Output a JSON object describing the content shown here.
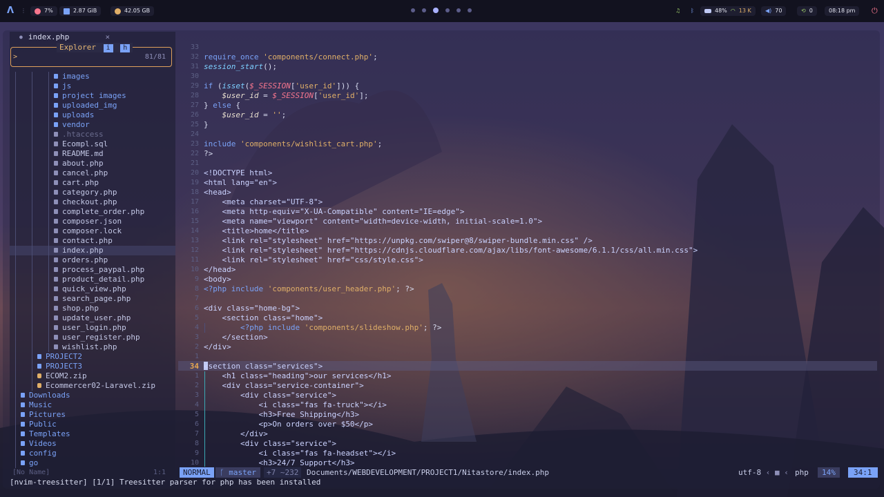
{
  "topbar": {
    "cpu": "7%",
    "ram": "2.87 GiB",
    "disk": "42.05 GB",
    "volume_level": "48%",
    "net_speed": "13 K",
    "volume": "70",
    "updates": "0",
    "clock": "08:18 pm"
  },
  "tab": {
    "filename": "index.php",
    "close": "×"
  },
  "explorer": {
    "title": "Explorer",
    "badge_i": "i",
    "badge_h": "h",
    "prompt": ">",
    "count": "81/81"
  },
  "tree": [
    {
      "label": "images",
      "kind": "dir"
    },
    {
      "label": "js",
      "kind": "dir"
    },
    {
      "label": "project images",
      "kind": "dir"
    },
    {
      "label": "uploaded_img",
      "kind": "dir"
    },
    {
      "label": "uploads",
      "kind": "dir"
    },
    {
      "label": "vendor",
      "kind": "dir"
    },
    {
      "label": ".htaccess",
      "kind": "dim"
    },
    {
      "label": "Ecompl.sql",
      "kind": "file"
    },
    {
      "label": "README.md",
      "kind": "file"
    },
    {
      "label": "about.php",
      "kind": "file"
    },
    {
      "label": "cancel.php",
      "kind": "file"
    },
    {
      "label": "cart.php",
      "kind": "file"
    },
    {
      "label": "category.php",
      "kind": "file"
    },
    {
      "label": "checkout.php",
      "kind": "file"
    },
    {
      "label": "complete_order.php",
      "kind": "file"
    },
    {
      "label": "composer.json",
      "kind": "file"
    },
    {
      "label": "composer.lock",
      "kind": "file"
    },
    {
      "label": "contact.php",
      "kind": "file"
    },
    {
      "label": "index.php",
      "kind": "file",
      "selected": true
    },
    {
      "label": "orders.php",
      "kind": "file"
    },
    {
      "label": "process_paypal.php",
      "kind": "file"
    },
    {
      "label": "product_detail.php",
      "kind": "file"
    },
    {
      "label": "quick_view.php",
      "kind": "file"
    },
    {
      "label": "search_page.php",
      "kind": "file"
    },
    {
      "label": "shop.php",
      "kind": "file"
    },
    {
      "label": "update_user.php",
      "kind": "file"
    },
    {
      "label": "user_login.php",
      "kind": "file"
    },
    {
      "label": "user_register.php",
      "kind": "file"
    },
    {
      "label": "wishlist.php",
      "kind": "file"
    },
    {
      "label": "PROJECT2",
      "kind": "dir"
    },
    {
      "label": "PROJECT3",
      "kind": "dir"
    },
    {
      "label": "ECOM2.zip",
      "kind": "zip"
    },
    {
      "label": "Ecommercer02-Laravel.zip",
      "kind": "zip"
    },
    {
      "label": "Downloads",
      "kind": "dir"
    },
    {
      "label": "Music",
      "kind": "dir"
    },
    {
      "label": "Pictures",
      "kind": "dir"
    },
    {
      "label": "Public",
      "kind": "dir"
    },
    {
      "label": "Templates",
      "kind": "dir"
    },
    {
      "label": "Videos",
      "kind": "dir"
    },
    {
      "label": "config",
      "kind": "dir"
    },
    {
      "label": "go",
      "kind": "dir"
    }
  ],
  "code": {
    "cursor_line": "34",
    "lines": [
      {
        "n": "33",
        "html": "<?php"
      },
      {
        "n": "32",
        "html": "<span class=\"kw\">require_once</span> <span class=\"str\">'components/connect.php'</span>;"
      },
      {
        "n": "31",
        "html": "<span class=\"fn\">session_start</span>();"
      },
      {
        "n": "30",
        "html": ""
      },
      {
        "n": "29",
        "html": "<span class=\"kw\">if</span> (<span class=\"fn\">isset</span>(<span class=\"sup\">$_SESSION</span>[<span class=\"str\">'user_id'</span>])) {"
      },
      {
        "n": "28",
        "html": "    <span class=\"var\">$user_id</span> = <span class=\"sup\">$_SESSION</span>[<span class=\"str\">'user_id'</span>];"
      },
      {
        "n": "27",
        "html": "} <span class=\"kw\">else</span> {"
      },
      {
        "n": "26",
        "html": "    <span class=\"var\">$user_id</span> = <span class=\"str\">''</span>;"
      },
      {
        "n": "25",
        "html": "}"
      },
      {
        "n": "24",
        "html": ""
      },
      {
        "n": "23",
        "html": "<span class=\"kw\">include</span> <span class=\"str\">'components/wishlist_cart.php'</span>;"
      },
      {
        "n": "22",
        "html": "?>"
      },
      {
        "n": "21",
        "html": ""
      },
      {
        "n": "20",
        "html": "<span class=\"tg\">&lt;!DOCTYPE html&gt;</span>"
      },
      {
        "n": "19",
        "html": "<span class=\"tg\">&lt;html lang=\"en\"&gt;</span>"
      },
      {
        "n": "18",
        "html": "<span class=\"tg\">&lt;head&gt;</span>"
      },
      {
        "n": "17",
        "html": "    <span class=\"tg\">&lt;meta charset=\"UTF-8\"&gt;</span>"
      },
      {
        "n": "16",
        "html": "    <span class=\"tg\">&lt;meta http-equiv=\"X-UA-Compatible\" content=\"IE=edge\"&gt;</span>"
      },
      {
        "n": "15",
        "html": "    <span class=\"tg\">&lt;meta name=\"viewport\" content=\"width=device-width, initial-scale=1.0\"&gt;</span>"
      },
      {
        "n": "14",
        "html": "    <span class=\"tg\">&lt;title&gt;home&lt;/title&gt;</span>"
      },
      {
        "n": "13",
        "html": "    <span class=\"tg\">&lt;link rel=\"stylesheet\" href=\"https://unpkg.com/swiper@8/swiper-bundle.min.css\" /&gt;</span>"
      },
      {
        "n": "12",
        "html": "    <span class=\"tg\">&lt;link rel=\"stylesheet\" href=\"https://cdnjs.cloudflare.com/ajax/libs/font-awesome/6.1.1/css/all.min.css\"&gt;</span>"
      },
      {
        "n": "11",
        "html": "    <span class=\"tg\">&lt;link rel=\"stylesheet\" href=\"css/style.css\"&gt;</span>"
      },
      {
        "n": "10",
        "html": "<span class=\"tg\">&lt;/head&gt;</span>"
      },
      {
        "n": "9",
        "html": "<span class=\"tg\">&lt;body&gt;</span>"
      },
      {
        "n": "8",
        "html": "<span class=\"kw\">&lt;?php include</span> <span class=\"str\">'components/user_header.php'</span>; ?&gt;"
      },
      {
        "n": "7",
        "html": ""
      },
      {
        "n": "6",
        "html": "<span class=\"tg\">&lt;div class=\"home-bg\"&gt;</span>"
      },
      {
        "n": "5",
        "html": "    <span class=\"tg\">&lt;section class=\"home\"&gt;</span>"
      },
      {
        "n": "4",
        "html": "        <span class=\"kw\">&lt;?php include</span> <span class=\"str\">'components/slideshow.php'</span>; ?&gt;"
      },
      {
        "n": "3",
        "html": "    <span class=\"tg\">&lt;/section&gt;</span>"
      },
      {
        "n": "2",
        "html": "<span class=\"tg\">&lt;/div&gt;</span>"
      },
      {
        "n": "1",
        "html": ""
      },
      {
        "n": "34",
        "html": "<span class=\"tg\">&lt;section class=\"services\"&gt;</span>",
        "cur": true
      },
      {
        "n": "1",
        "html": "    <span class=\"tg\">&lt;h1 class=\"heading\"&gt;our services&lt;/h1&gt;</span>"
      },
      {
        "n": "2",
        "html": "    <span class=\"tg\">&lt;div class=\"service-container\"&gt;</span>"
      },
      {
        "n": "3",
        "html": "        <span class=\"tg\">&lt;div class=\"service\"&gt;</span>"
      },
      {
        "n": "4",
        "html": "            <span class=\"tg\">&lt;i class=\"fas fa-truck\"&gt;&lt;/i&gt;</span>"
      },
      {
        "n": "5",
        "html": "            <span class=\"tg\">&lt;h3&gt;Free Shipping&lt;/h3&gt;</span>"
      },
      {
        "n": "6",
        "html": "            <span class=\"tg\">&lt;p&gt;On orders over $50&lt;/p&gt;</span>"
      },
      {
        "n": "7",
        "html": "        <span class=\"tg\">&lt;/div&gt;</span>"
      },
      {
        "n": "8",
        "html": "        <span class=\"tg\">&lt;div class=\"service\"&gt;</span>"
      },
      {
        "n": "9",
        "html": "            <span class=\"tg\">&lt;i class=\"fas fa-headset\"&gt;&lt;/i&gt;</span>"
      },
      {
        "n": "10",
        "html": "            <span class=\"tg\">&lt;h3&gt;24/7 Support&lt;/h3&gt;</span>"
      }
    ]
  },
  "status": {
    "noname": "[No Name]",
    "noname_pos": "1:1",
    "mode": "NORMAL",
    "branch": "master",
    "diff": "+7 ~232",
    "path": "Documents/WEBDEVELOPMENT/PROJECT1/Nitastore/index.php",
    "encoding": "utf-8",
    "filetype": "php",
    "percent": "14%",
    "position": "34:1"
  },
  "message": "[nvim-treesitter] [1/1] Treesitter parser for php has been installed",
  "colors": {
    "accent": "#7aa2f7",
    "orange": "#e0a15c",
    "bar": "#12121f"
  }
}
